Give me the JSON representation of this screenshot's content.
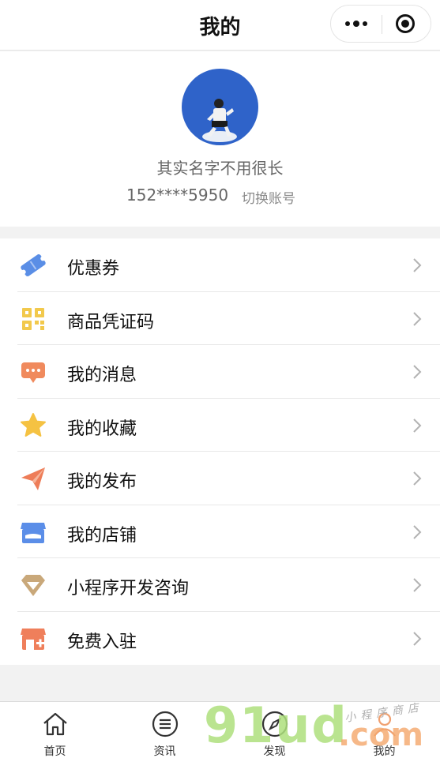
{
  "navbar": {
    "title": "我的",
    "more_icon": "more-dots-icon",
    "close_icon": "target-circle-icon"
  },
  "profile": {
    "nickname": "其实名字不用很长",
    "phone": "152****5950",
    "switch_account": "切换账号",
    "avatar_color": "#2f63c9"
  },
  "menu": {
    "items": [
      {
        "label": "优惠券",
        "icon": "coupon-icon"
      },
      {
        "label": "商品凭证码",
        "icon": "qrcode-icon"
      },
      {
        "label": "我的消息",
        "icon": "message-icon"
      },
      {
        "label": "我的收藏",
        "icon": "star-icon"
      },
      {
        "label": "我的发布",
        "icon": "paper-plane-icon"
      },
      {
        "label": "我的店铺",
        "icon": "store-icon"
      },
      {
        "label": "小程序开发咨询",
        "icon": "diamond-icon"
      },
      {
        "label": "免费入驻",
        "icon": "shop-add-icon"
      }
    ]
  },
  "tabbar": {
    "tabs": [
      {
        "label": "首页",
        "icon": "home-icon"
      },
      {
        "label": "资讯",
        "icon": "list-icon"
      },
      {
        "label": "发现",
        "icon": "compass-icon"
      },
      {
        "label": "我的",
        "icon": "user-icon"
      }
    ]
  },
  "watermark": {
    "main": "91ud",
    "suffix": ".com",
    "small": "小程序商店"
  },
  "colors": {
    "coupon": "#5a8ee6",
    "qrcode": "#f2c94c",
    "message": "#f08a5d",
    "star": "#f5c242",
    "plane": "#ee7d58",
    "store": "#5b8ee8",
    "diamond": "#c9a87a",
    "shop_add": "#ef7f5b"
  }
}
